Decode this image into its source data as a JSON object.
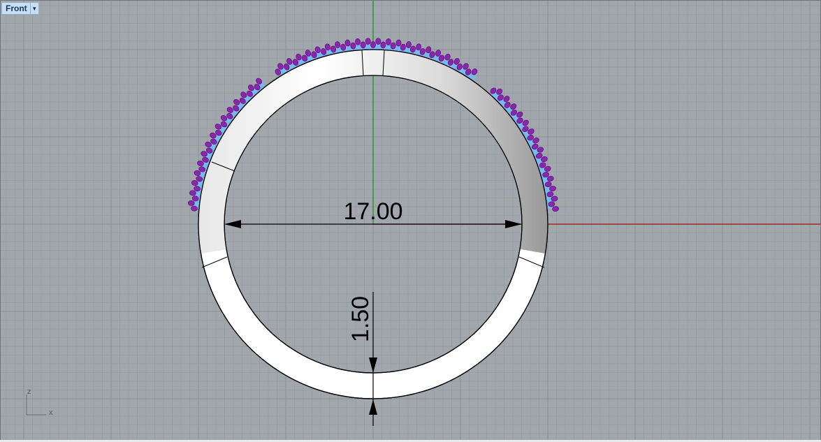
{
  "viewport": {
    "name": "Front",
    "menu_icon": "chevron-down-icon"
  },
  "axis_icon": {
    "z_label": "z",
    "x_label": "x"
  },
  "dimensions": {
    "diameter_label": "17.00",
    "thickness_label": "1.50"
  },
  "colors": {
    "background": "#a2a7ad",
    "grid_minor": "#969ba1",
    "grid_major": "#8b9096",
    "x_axis": "#a1100e",
    "y_axis": "#1a8c1a",
    "gem_purple": "#8a25b0",
    "gem_blue": "#79b9ef"
  }
}
